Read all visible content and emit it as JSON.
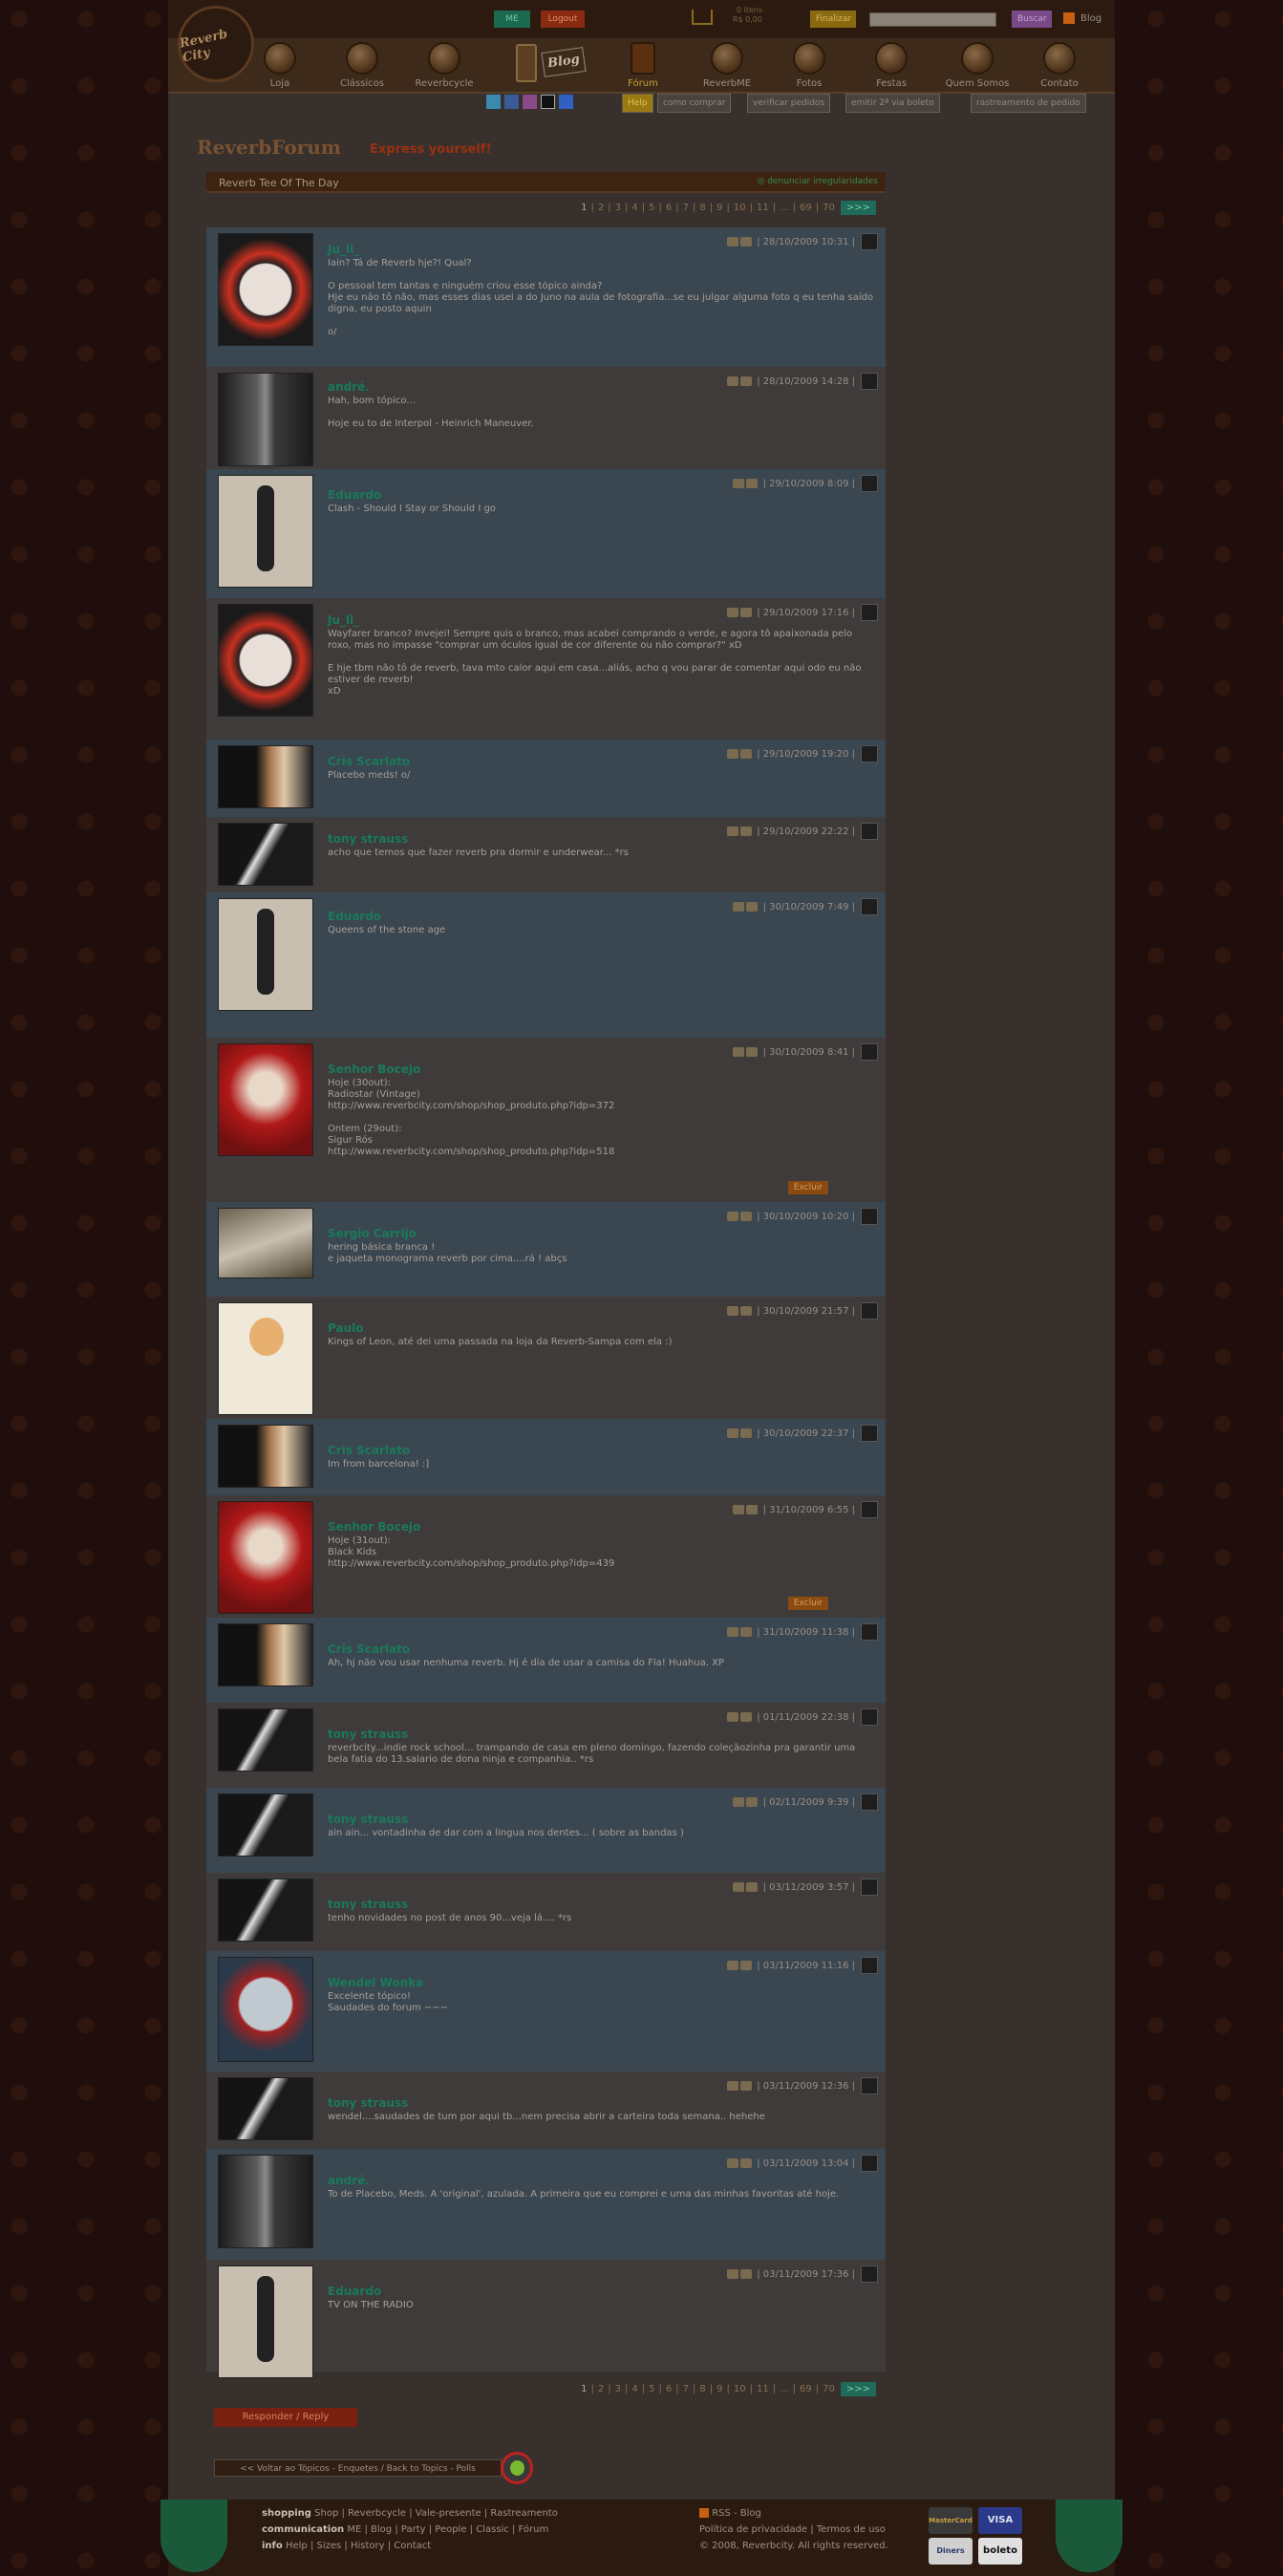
{
  "header": {
    "me_label": "ME",
    "logout_label": "Logout",
    "cart_items": "0 itens",
    "cart_total": "R$ 0,00",
    "finalize_label": "Finalizar",
    "search_label": "Buscar",
    "blog_label": "Blog",
    "logo_text": "Reverb City"
  },
  "nav": [
    {
      "label": "Loja",
      "active": false
    },
    {
      "label": "Clássicos",
      "active": false
    },
    {
      "label": "Reverbcycle",
      "active": false
    },
    {
      "label": "Blog",
      "active": false
    },
    {
      "label": "Fórum",
      "active": true
    },
    {
      "label": "ReverbME",
      "active": false
    },
    {
      "label": "Fotos",
      "active": false
    },
    {
      "label": "Festas",
      "active": false
    },
    {
      "label": "Quem Somos",
      "active": false
    },
    {
      "label": "Contato",
      "active": false
    }
  ],
  "subnav": {
    "help": "Help",
    "comprar": "como comprar",
    "pedidos": "verificar pedidos",
    "boleto": "emitir 2ª via boleto",
    "rastreamento": "rastreamento de pedido"
  },
  "forum": {
    "title": "ReverbForum",
    "subtitle": "Express yourself!",
    "thread": "Reverb Tee Of The Day",
    "report": "denunciar irregularidades"
  },
  "pager": {
    "pages": [
      "1",
      "2",
      "3",
      "4",
      "5",
      "6",
      "7",
      "8",
      "9",
      "10",
      "11",
      "...",
      "69",
      "70"
    ],
    "next": ">>>"
  },
  "posts": [
    {
      "author": "Ju_li_",
      "date": "28/10/2009 10:31",
      "body": "Iain? Tá de Reverb hje?! Qual?\n\nO pessoal tem tantas e ninguém criou esse tópico ainda?\nHje eu não tô não, mas esses dias usei a do Juno na aula de fotografia...se eu julgar alguma foto q eu tenha saído digna, eu posto aquin\n\no/"
    },
    {
      "author": "andré.",
      "date": "28/10/2009 14:28",
      "body": "Hah, bom tópico...\n\nHoje eu to de Interpol - Heinrich Maneuver."
    },
    {
      "author": "Eduardo",
      "date": "29/10/2009 8:09",
      "body": "Clash - Should I Stay or Should I go"
    },
    {
      "author": "Ju_li_",
      "date": "29/10/2009 17:16",
      "body": "Wayfarer branco? Invejei! Sempre quis o branco, mas acabei comprando o verde, e agora tô apaixonada pelo roxo, mas no impasse \"comprar um óculos igual de cor diferente ou não comprar?\" xD\n\nE hje tbm não tô de reverb, tava mto calor aqui em casa...aliás, acho q vou parar de comentar aqui odo eu não estiver de reverb!\nxD"
    },
    {
      "author": "Cris Scarlato",
      "date": "29/10/2009 19:20",
      "body": "Placebo meds! o/"
    },
    {
      "author": "tony strauss",
      "date": "29/10/2009 22:22",
      "body": "acho que temos que fazer reverb pra dormir e underwear... *rs"
    },
    {
      "author": "Eduardo",
      "date": "30/10/2009 7:49",
      "body": "Queens of the stone age"
    },
    {
      "author": "Senhor Bocejo",
      "date": "30/10/2009 8:41",
      "body": "Hoje (30out):\nRadiostar (Vintage)\nhttp://www.reverbcity.com/shop/shop_produto.php?idp=372\n\nOntem (29out):\nSigur Rós\nhttp://www.reverbcity.com/shop/shop_produto.php?idp=518",
      "excluir": "Excluir"
    },
    {
      "author": "Sergio Carrijo",
      "date": "30/10/2009 10:20",
      "body": "hering básica branca !\ne jaqueta monograma reverb por cima....rá ! abçs"
    },
    {
      "author": "Paulo",
      "date": "30/10/2009 21:57",
      "body": "Kings of Leon, até dei uma passada na loja da Reverb-Sampa com ela :)"
    },
    {
      "author": "Cris Scarlato",
      "date": "30/10/2009 22:37",
      "body": "Im from barcelona! :]"
    },
    {
      "author": "Senhor Bocejo",
      "date": "31/10/2009 6:55",
      "body": "Hoje (31out):\nBlack Kids\nhttp://www.reverbcity.com/shop/shop_produto.php?idp=439",
      "excluir": "Excluir"
    },
    {
      "author": "Cris Scarlato",
      "date": "31/10/2009 11:38",
      "body": "Ah, hj não vou usar nenhuma reverb. Hj é dia de usar a camisa do Fla! Huahua. XP"
    },
    {
      "author": "tony strauss",
      "date": "01/11/2009 22:38",
      "body": "reverbcity...indie rock school... trampando de casa em pleno domingo, fazendo coleçãozinha pra garantir uma bela fatia do 13.salario de dona ninja e companhia.. *rs"
    },
    {
      "author": "tony strauss",
      "date": "02/11/2009 9:39",
      "body": "ain ain... vontadinha de dar com a lingua nos dentes... ( sobre as bandas )"
    },
    {
      "author": "tony strauss",
      "date": "03/11/2009 3:57",
      "body": "tenho novidades no post de anos 90...veja lá.... *rs"
    },
    {
      "author": "Wendel Wonka",
      "date": "03/11/2009 11:16",
      "body": "Excelente tópico!\nSaudades do forum ~~~"
    },
    {
      "author": "tony strauss",
      "date": "03/11/2009 12:36",
      "body": "wendel....saudades de tum por aqui tb...nem precisa abrir a carteira toda semana.. hehehe"
    },
    {
      "author": "andré.",
      "date": "03/11/2009 13:04",
      "body": "To de Placebo, Meds. A 'original', azulada. A primeira que eu comprei e uma das minhas favoritas até hoje."
    },
    {
      "author": "Eduardo",
      "date": "03/11/2009 17:36",
      "body": "TV ON THE RADIO"
    }
  ],
  "actions": {
    "reply": "Responder / Reply",
    "back": "<< Voltar ao Tópicos - Enquetes / Back to Topics - Polls"
  },
  "footer": {
    "shopping_label": "shopping",
    "shopping_links": "Shop | Reverbcycle | Vale-presente | Rastreamento",
    "communication_label": "communication",
    "communication_links": "ME | Blog | Party | People | Classic | Fórum",
    "info_label": "info",
    "info_links": "Help | Sizes | History | Contact",
    "rss": "RSS - Blog",
    "privacy": "Política de privacidade",
    "terms": "Termos de uso",
    "copyright": "© 2008, Reverbcity. All rights reserved.",
    "cards": [
      "MasterCard",
      "VISA",
      "Diners",
      "boleto"
    ]
  }
}
